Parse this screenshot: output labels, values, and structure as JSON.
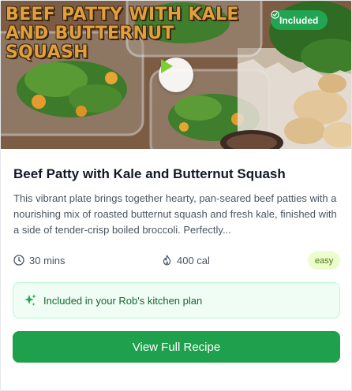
{
  "recipe": {
    "hero_title": "BEEF PATTY WITH KALE AND BUTTERNUT SQUASH",
    "included_badge": "Included",
    "title": "Beef Patty with Kale and Butternut Squash",
    "description": "This vibrant plate brings together hearty, pan-seared beef patties with a nourishing mix of roasted butternut squash and fresh kale, finished with a side of tender-crisp boiled broccoli. Perfectly...",
    "time": "30 mins",
    "calories": "400 cal",
    "difficulty": "easy",
    "plan_note": "Included in your Rob's kitchen plan",
    "cta_label": "View Full Recipe"
  },
  "icons": {
    "badge": "check-circle-icon",
    "play": "play-icon",
    "time": "clock-icon",
    "calories": "flame-icon",
    "plan": "sparkles-icon"
  },
  "colors": {
    "accent": "#1fa04c",
    "badge_bg": "#22a552",
    "difficulty_bg": "#ecfccb",
    "difficulty_text": "#4d7c0f",
    "plan_bg": "#f0fdf4",
    "plan_border": "#bbf7d0"
  }
}
